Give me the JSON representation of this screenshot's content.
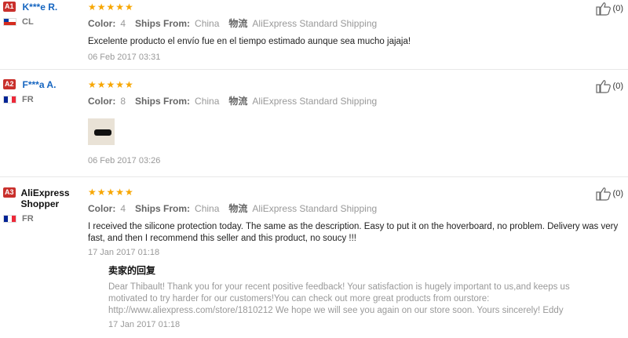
{
  "reviews": [
    {
      "badge": "A1",
      "name": "K***e R.",
      "country": "CL",
      "stars": "★★★★★",
      "color_label": "Color:",
      "color_value": "4",
      "ships_label": "Ships From:",
      "ships_value": "China",
      "logistics_label": "物流",
      "logistics_value": "AliExpress Standard Shipping",
      "text": "Excelente producto el envío fue en el tiempo estimado aunque sea mucho jajaja!",
      "date": "06 Feb 2017 03:31",
      "likes": "(0)"
    },
    {
      "badge": "A2",
      "name": "F***a A.",
      "country": "FR",
      "stars": "★★★★★",
      "color_label": "Color:",
      "color_value": "8",
      "ships_label": "Ships From:",
      "ships_value": "China",
      "logistics_label": "物流",
      "logistics_value": "AliExpress Standard Shipping",
      "date": "06 Feb 2017 03:26",
      "likes": "(0)"
    },
    {
      "badge": "A3",
      "name": "AliExpress Shopper",
      "country": "FR",
      "stars": "★★★★★",
      "color_label": "Color:",
      "color_value": "4",
      "ships_label": "Ships From:",
      "ships_value": "China",
      "logistics_label": "物流",
      "logistics_value": "AliExpress Standard Shipping",
      "text": "I received the silicone protection today. The same as the description. Easy to put it on the hoverboard, no problem. Delivery was very fast, and then I recommend this seller and this product, no soucy !!!",
      "date": "17 Jan 2017 01:18",
      "likes": "(0)",
      "reply": {
        "title": "卖家的回复",
        "text": "Dear Thibault! Thank you for your recent positive feedback! Your satisfaction is hugely important to us,and keeps us motivated to try harder for our customers!You can check out more great products from ourstore: http://www.aliexpress.com/store/1810212 We hope we will see you again on our store soon. Yours sincerely! Eddy",
        "date": "17 Jan 2017 01:18"
      }
    }
  ],
  "colors": {
    "star": "#f7a600",
    "badge": "#c9302c",
    "username": "#1565c0"
  },
  "icons": {
    "like": "thumbs-up-icon",
    "star": "star-icon"
  }
}
